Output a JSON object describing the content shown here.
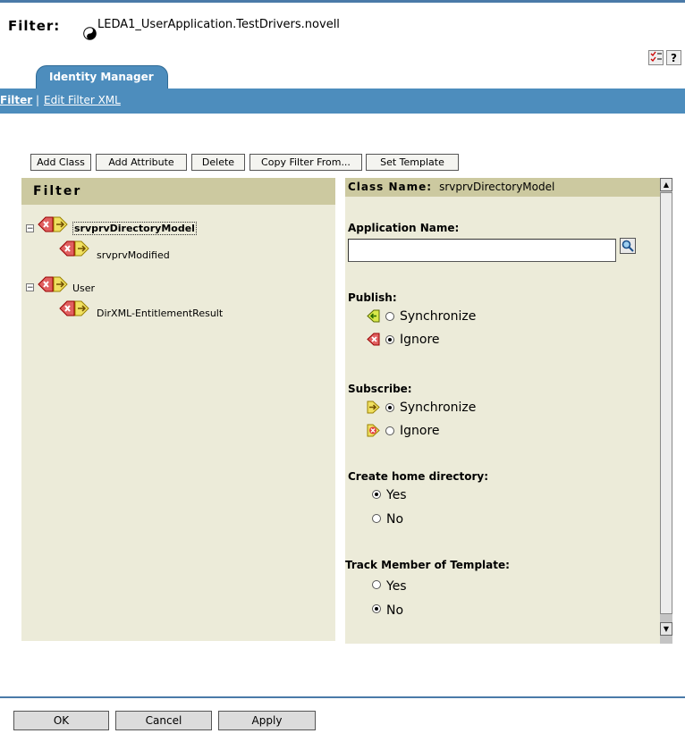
{
  "header": {
    "title_label": "Filter:",
    "object_name": "LEDA1_UserApplication.TestDrivers.novell",
    "help_icon_text": "?"
  },
  "tab": {
    "label": "Identity Manager"
  },
  "subnav": {
    "filter": "Filter",
    "separator": "|",
    "edit_xml": "Edit Filter XML"
  },
  "toolbar": {
    "add_class": "Add Class",
    "add_attribute": "Add Attribute",
    "delete": "Delete",
    "copy_filter": "Copy Filter From...",
    "set_template": "Set Template"
  },
  "left_pane": {
    "header": "Filter",
    "tree": [
      {
        "label": "srvprvDirectoryModel",
        "level": 0,
        "selected": true,
        "expanded": true
      },
      {
        "label": "srvprvModified",
        "level": 1
      },
      {
        "label": "User",
        "level": 0,
        "expanded": true
      },
      {
        "label": "DirXML-EntitlementResult",
        "level": 1
      }
    ]
  },
  "right_pane": {
    "class_name_label": "Class Name:",
    "class_name_value": "srvprvDirectoryModel",
    "app_name_label": "Application Name:",
    "app_name_value": "",
    "publish_label": "Publish:",
    "publish_options": [
      "Synchronize",
      "Ignore"
    ],
    "publish_selected": "Ignore",
    "subscribe_label": "Subscribe:",
    "subscribe_options": [
      "Synchronize",
      "Ignore"
    ],
    "subscribe_selected": "Synchronize",
    "home_dir_label": "Create home directory:",
    "home_dir_options": [
      "Yes",
      "No"
    ],
    "home_dir_selected": "Yes",
    "track_label": "Track Member of Template:",
    "track_options": [
      "Yes",
      "No"
    ],
    "track_selected": "No"
  },
  "footer": {
    "ok": "OK",
    "cancel": "Cancel",
    "apply": "Apply"
  },
  "colors": {
    "accent_blue": "#4d8dbd",
    "pane_bg": "#ecebd9",
    "pane_header": "#ccc9a0"
  }
}
